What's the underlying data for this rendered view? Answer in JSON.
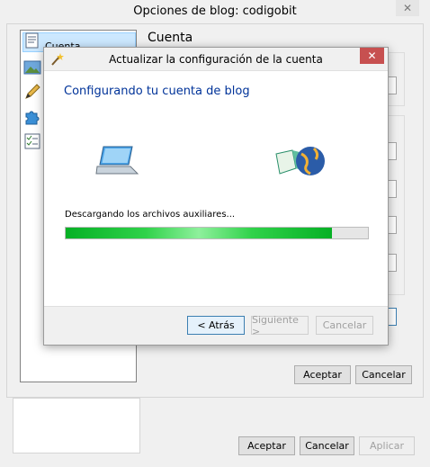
{
  "outer_window": {
    "title": "Opciones de blog: codigobit",
    "close_label": "✕",
    "buttons": {
      "accept": "Aceptar",
      "cancel": "Cancelar",
      "apply": "Aplicar"
    }
  },
  "inner_dialog": {
    "sidebar": {
      "items": [
        {
          "label": "Cuenta",
          "icon": "account-icon"
        },
        {
          "icon": "image-icon"
        },
        {
          "icon": "pencil-icon"
        },
        {
          "icon": "puzzle-icon"
        },
        {
          "icon": "checklist-icon"
        }
      ]
    },
    "section_title": "Cuenta",
    "buttons": {
      "accept": "Aceptar",
      "cancel": "Cancelar"
    }
  },
  "wizard": {
    "title": "Actualizar la configuración de la cuenta",
    "close_label": "✕",
    "heading": "Configurando tu cuenta de blog",
    "status_text": "Descargando los archivos auxiliares...",
    "progress": 0.88,
    "buttons": {
      "back": "< Atrás",
      "next": "Siguiente >",
      "cancel": "Cancelar"
    }
  },
  "colors": {
    "accent": "#003399",
    "progress_green": "#06b025",
    "close_red": "#c75050"
  }
}
